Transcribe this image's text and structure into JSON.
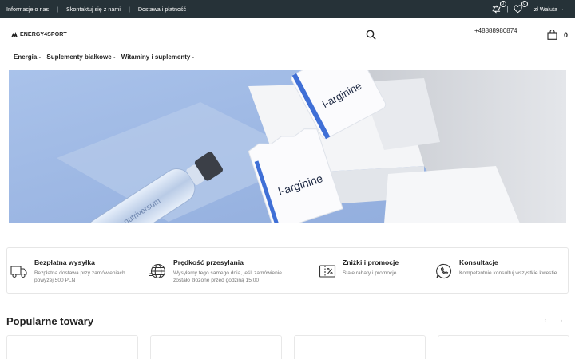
{
  "topbar": {
    "links": [
      "Informacje o nas",
      "Skontaktuj się z nami",
      "Dostawa i płatność"
    ],
    "compare_badge": "0",
    "wishlist_badge": "0",
    "currency_label": "zł Waluta",
    "compare_icon": "compare-arrows-icon",
    "wishlist_icon": "heart-icon"
  },
  "header": {
    "logo_text": "ENERGY4SPORT",
    "phone": "+48888980874",
    "cart_count": "0"
  },
  "nav": {
    "items": [
      "Energia",
      "Suplementy białkowe",
      "Witaminy i suplementy"
    ]
  },
  "features": [
    {
      "title": "Bezpłatna wysyłka",
      "desc_line1": "Bezpłatna dostawa przy zamówieniach",
      "desc_line2": "powyżej 500 PLN",
      "icon": "delivery-truck-icon"
    },
    {
      "title": "Prędkość przesyłania",
      "desc_line1": "Wysyłamy tego samego dnia, jeśli zamówienie",
      "desc_line2": "zostało złożone przed godziną 15:00",
      "icon": "globe-icon"
    },
    {
      "title": "Zniżki i promocje",
      "desc_line1": "Stałe rabaty i promocje",
      "desc_line2": "",
      "icon": "discount-tag-icon"
    },
    {
      "title": "Konsultacje",
      "desc_line1": "Kompetentnie konsultuj wszystkie kwestie",
      "desc_line2": "",
      "icon": "phone-chat-icon"
    }
  ],
  "popular": {
    "title": "Popularne towary",
    "prev_label": "‹",
    "next_label": "›"
  },
  "hero": {
    "bottle_text": "nutriversum",
    "bag_text": "l-arginine"
  },
  "colors": {
    "topbar": "#263238",
    "hero_bg": "#9fb8e3",
    "text": "#222222"
  }
}
